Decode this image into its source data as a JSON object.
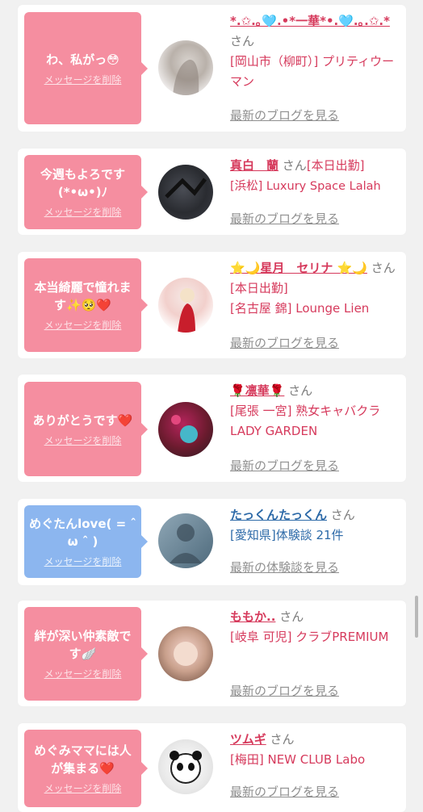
{
  "colors": {
    "pink_bubble": "#f58ea0",
    "blue_bubble": "#8cb6ef",
    "name_pink": "#d63a5c",
    "name_blue": "#2d6aa8"
  },
  "delete_label": "メッセージを削除",
  "san": "さん",
  "cards": [
    {
      "message": "わ、私がっ😳",
      "name": "*.✩.｡🩵.•*一華*•.🩵.｡.✩.*",
      "status": "",
      "shop": "[岡山市（柳町）] プリティウーマン",
      "link": "最新のブログを見る",
      "type": "pink"
    },
    {
      "message": "今週もよろです(*•ω•)ﾉ",
      "name": "真白　蘭",
      "status": "[本日出勤]",
      "shop": "[浜松] Luxury Space Lalah",
      "link": "最新のブログを見る",
      "type": "pink"
    },
    {
      "message": "本当綺麗で憧れます✨🥺❤️",
      "name": "⭐🌙星月　セリナ ⭐🌙",
      "status": "[本日出勤]",
      "shop": "[名古屋 錦] Lounge Lien",
      "link": "最新のブログを見る",
      "type": "pink"
    },
    {
      "message": "ありがとうです❤️",
      "name": "🌹凛華🌹",
      "status": "",
      "shop": "[尾張 一宮] 熟女キャバクラ LADY GARDEN",
      "link": "最新のブログを見る",
      "type": "pink"
    },
    {
      "message": "めぐたんlove( = ˆ ω ˆ )",
      "name": "たっくんたっくん",
      "status": "",
      "shop": "[愛知県]体験談 21件",
      "link": "最新の体験談を見る",
      "type": "blue"
    },
    {
      "message": "絆が深い仲素敵です🪽",
      "name": "ももか..",
      "status": "",
      "shop": "[岐阜 可児] クラブPREMIUM",
      "link": "最新のブログを見る",
      "type": "pink"
    },
    {
      "message": "めぐみママには人が集まる❤️",
      "name": "ツムギ",
      "status": "",
      "shop": "[梅田] NEW CLUB Labo",
      "link": "最新のブログを見る",
      "type": "pink"
    }
  ]
}
